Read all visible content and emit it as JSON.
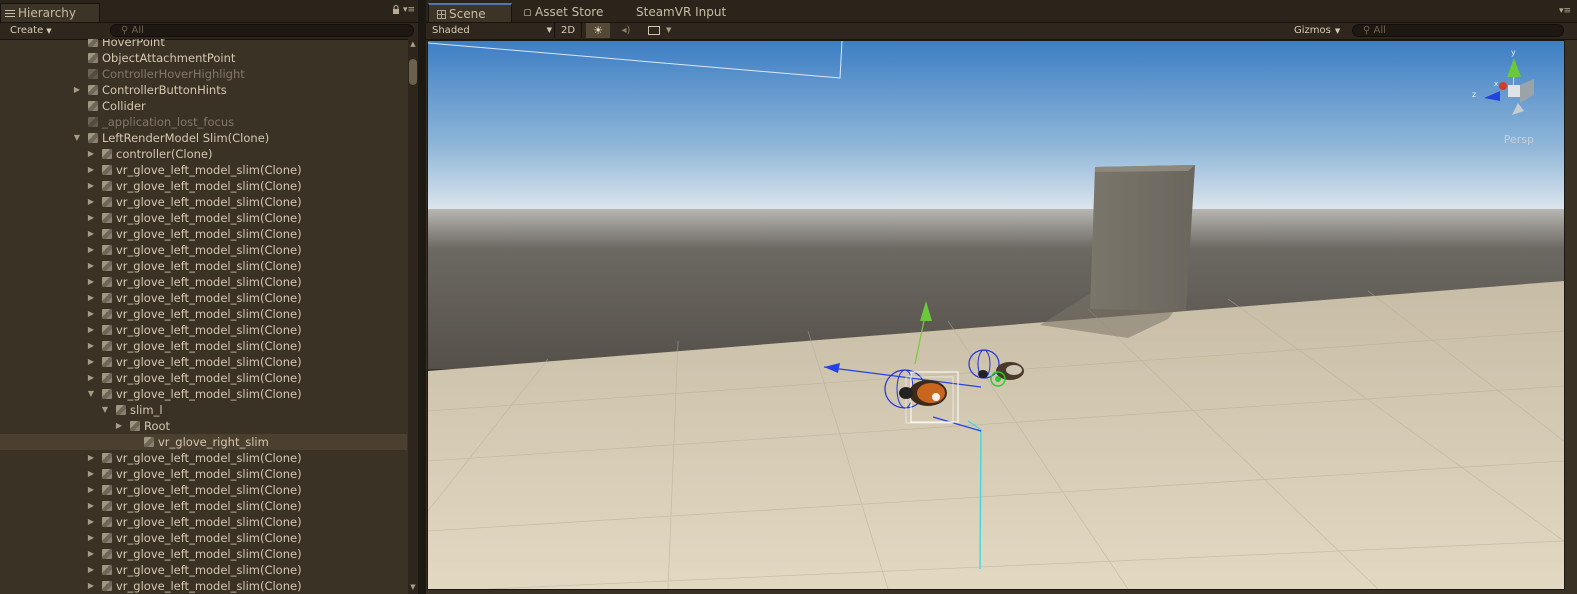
{
  "hierarchy": {
    "tab_label": "Hierarchy",
    "lock_icon": "lock-icon",
    "menu_icon": "▾≡",
    "create_label": "Create",
    "search_placeholder": "All",
    "rows": [
      {
        "label": "HoverPoint",
        "indent": 0,
        "toggle": "",
        "state": "normal"
      },
      {
        "label": "ObjectAttachmentPoint",
        "indent": 0,
        "toggle": "",
        "state": "normal"
      },
      {
        "label": "ControllerHoverHighlight",
        "indent": 0,
        "toggle": "",
        "state": "dim"
      },
      {
        "label": "ControllerButtonHints",
        "indent": 0,
        "toggle": "▶",
        "state": "normal"
      },
      {
        "label": "Collider",
        "indent": 0,
        "toggle": "",
        "state": "normal"
      },
      {
        "label": "_application_lost_focus",
        "indent": 0,
        "toggle": "",
        "state": "dim"
      },
      {
        "label": "LeftRenderModel Slim(Clone)",
        "indent": 0,
        "toggle": "▼",
        "state": "normal"
      },
      {
        "label": "controller(Clone)",
        "indent": 1,
        "toggle": "▶",
        "state": "normal"
      },
      {
        "label": "vr_glove_left_model_slim(Clone)",
        "indent": 1,
        "toggle": "▶",
        "state": "normal"
      },
      {
        "label": "vr_glove_left_model_slim(Clone)",
        "indent": 1,
        "toggle": "▶",
        "state": "normal"
      },
      {
        "label": "vr_glove_left_model_slim(Clone)",
        "indent": 1,
        "toggle": "▶",
        "state": "normal"
      },
      {
        "label": "vr_glove_left_model_slim(Clone)",
        "indent": 1,
        "toggle": "▶",
        "state": "normal"
      },
      {
        "label": "vr_glove_left_model_slim(Clone)",
        "indent": 1,
        "toggle": "▶",
        "state": "normal"
      },
      {
        "label": "vr_glove_left_model_slim(Clone)",
        "indent": 1,
        "toggle": "▶",
        "state": "normal"
      },
      {
        "label": "vr_glove_left_model_slim(Clone)",
        "indent": 1,
        "toggle": "▶",
        "state": "normal"
      },
      {
        "label": "vr_glove_left_model_slim(Clone)",
        "indent": 1,
        "toggle": "▶",
        "state": "normal"
      },
      {
        "label": "vr_glove_left_model_slim(Clone)",
        "indent": 1,
        "toggle": "▶",
        "state": "normal"
      },
      {
        "label": "vr_glove_left_model_slim(Clone)",
        "indent": 1,
        "toggle": "▶",
        "state": "normal"
      },
      {
        "label": "vr_glove_left_model_slim(Clone)",
        "indent": 1,
        "toggle": "▶",
        "state": "normal"
      },
      {
        "label": "vr_glove_left_model_slim(Clone)",
        "indent": 1,
        "toggle": "▶",
        "state": "normal"
      },
      {
        "label": "vr_glove_left_model_slim(Clone)",
        "indent": 1,
        "toggle": "▶",
        "state": "normal"
      },
      {
        "label": "vr_glove_left_model_slim(Clone)",
        "indent": 1,
        "toggle": "▶",
        "state": "normal"
      },
      {
        "label": "vr_glove_left_model_slim(Clone)",
        "indent": 1,
        "toggle": "▼",
        "state": "normal"
      },
      {
        "label": "slim_l",
        "indent": 2,
        "toggle": "▼",
        "state": "normal"
      },
      {
        "label": "Root",
        "indent": 3,
        "toggle": "▶",
        "state": "normal"
      },
      {
        "label": "vr_glove_right_slim",
        "indent": 4,
        "toggle": "",
        "state": "selected"
      },
      {
        "label": "vr_glove_left_model_slim(Clone)",
        "indent": 1,
        "toggle": "▶",
        "state": "normal"
      },
      {
        "label": "vr_glove_left_model_slim(Clone)",
        "indent": 1,
        "toggle": "▶",
        "state": "normal"
      },
      {
        "label": "vr_glove_left_model_slim(Clone)",
        "indent": 1,
        "toggle": "▶",
        "state": "normal"
      },
      {
        "label": "vr_glove_left_model_slim(Clone)",
        "indent": 1,
        "toggle": "▶",
        "state": "normal"
      },
      {
        "label": "vr_glove_left_model_slim(Clone)",
        "indent": 1,
        "toggle": "▶",
        "state": "normal"
      },
      {
        "label": "vr_glove_left_model_slim(Clone)",
        "indent": 1,
        "toggle": "▶",
        "state": "normal"
      },
      {
        "label": "vr_glove_left_model_slim(Clone)",
        "indent": 1,
        "toggle": "▶",
        "state": "normal"
      },
      {
        "label": "vr_glove_left_model_slim(Clone)",
        "indent": 1,
        "toggle": "▶",
        "state": "normal"
      },
      {
        "label": "vr_glove_left_model_slim(Clone)",
        "indent": 1,
        "toggle": "▶",
        "state": "normal"
      }
    ]
  },
  "scene": {
    "tabs": [
      {
        "label": "Scene",
        "icon": "scene-grid-icon",
        "active": true
      },
      {
        "label": "Asset Store",
        "icon": "asset-store-lock-icon",
        "active": false
      },
      {
        "label": "SteamVR Input",
        "icon": "",
        "active": false
      }
    ],
    "menu_icon": "▾≡",
    "shading_mode": "Shaded",
    "mode_2d_label": "2D",
    "lighting_icon": "☀",
    "audio_icon": "◂)",
    "effects_icon": "image-effects-icon",
    "gizmos_label": "Gizmos",
    "search_placeholder": "All",
    "projection_label": "Persp",
    "colors": {
      "sky_top": "#3f80c4",
      "horizon": "#dfe8ef",
      "ground_far": "#5a5550",
      "floor": "#d6ccb4",
      "x_axis": "#d33a2a",
      "y_axis": "#7ac93a",
      "z_axis": "#2443e0",
      "cyan_line": "#3fd8e2"
    }
  }
}
